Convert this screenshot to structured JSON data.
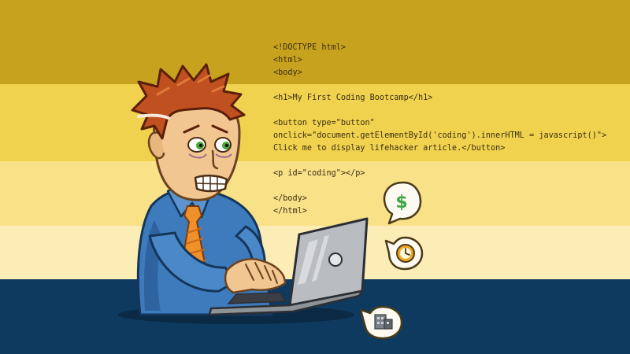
{
  "colors": {
    "band_dark_gold": "#c7a21e",
    "band_gold": "#f1d24f",
    "band_light_yellow": "#f8e187",
    "band_cream": "#fcedb6",
    "desk_navy": "#0f3a5f",
    "code_text": "#3a2e12",
    "shirt_blue": "#3e7bbd",
    "tie_orange": "#f0902a",
    "hair_rust": "#c0501f",
    "laptop_silver": "#b9bcc0"
  },
  "code_lines": [
    "<!DOCTYPE html>",
    "<html>",
    "<body>",
    "",
    "<h1>My First Coding Bootcamp</h1>",
    "",
    "<button type=\"button\"",
    "onclick=\"document.getElementById('coding').innerHTML = javascript()\">",
    "Click me to display lifehacker article.</button>",
    "",
    "<p id=\"coding\"></p>",
    "",
    "</body>",
    "</html>"
  ],
  "icons": [
    "dollar-icon",
    "clock-icon",
    "building-icon"
  ]
}
